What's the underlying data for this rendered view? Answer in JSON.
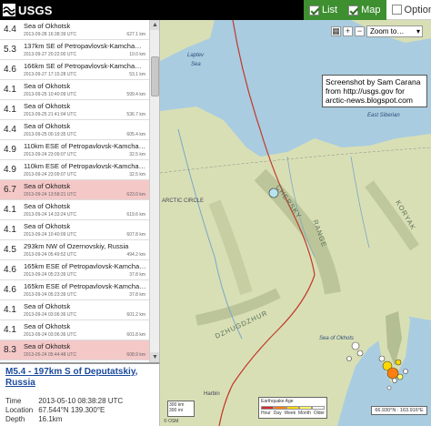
{
  "header": {
    "logo_text": "USGS",
    "view_toggle": [
      {
        "label": "List",
        "checked": true
      },
      {
        "label": "Map",
        "checked": true
      },
      {
        "label": "Options",
        "checked": false
      }
    ]
  },
  "earthquakes": [
    {
      "mag": "4.4",
      "place": "Sea of Okhotsk",
      "time": "2013-09-28 16:38:39 UTC",
      "depth": "627.1 km",
      "highlight": false
    },
    {
      "mag": "5.3",
      "place": "137km SE of Petropavlovsk-Kamcha…",
      "time": "2013-09-27 20:22:00 UTC",
      "depth": "10.0 km",
      "highlight": false
    },
    {
      "mag": "4.6",
      "place": "166km SE of Petropavlovsk-Kamcha…",
      "time": "2013-09-27 17:15:28 UTC",
      "depth": "53.1 km",
      "highlight": false
    },
    {
      "mag": "4.1",
      "place": "Sea of Okhotsk",
      "time": "2013-09-25 10:40:09 UTC",
      "depth": "599.4 km",
      "highlight": false
    },
    {
      "mag": "4.1",
      "place": "Sea of Okhotsk",
      "time": "2013-09-25 21:41:04 UTC",
      "depth": "536.7 km",
      "highlight": false
    },
    {
      "mag": "4.4",
      "place": "Sea of Okhotsk",
      "time": "2013-09-25 00:19:35 UTC",
      "depth": "605.4 km",
      "highlight": false
    },
    {
      "mag": "4.9",
      "place": "110km ESE of Petropavlovsk-Kamcha…",
      "time": "2013-09-24 23:09:07 UTC",
      "depth": "32.5 km",
      "highlight": false
    },
    {
      "mag": "4.9",
      "place": "110km ESE of Petropavlovsk-Kamcha…",
      "time": "2013-09-24 23:09:07 UTC",
      "depth": "32.5 km",
      "highlight": false
    },
    {
      "mag": "6.7",
      "place": "Sea of Okhotsk",
      "time": "2013-09-24 13:58:21 UTC",
      "depth": "623.0 km",
      "highlight": true
    },
    {
      "mag": "4.1",
      "place": "Sea of Okhotsk",
      "time": "2013-09-24 14:33:24 UTC",
      "depth": "619.6 km",
      "highlight": false
    },
    {
      "mag": "4.1",
      "place": "Sea of Okhotsk",
      "time": "2013-09-24 10:40:09 UTC",
      "depth": "607.8 km",
      "highlight": false
    },
    {
      "mag": "4.5",
      "place": "293km NW of Ozernovskiy, Russia",
      "time": "2013-09-24 05:49:52 UTC",
      "depth": "494.2 km",
      "highlight": false
    },
    {
      "mag": "4.6",
      "place": "165km ESE of Petropavlovsk-Kamcha…",
      "time": "2013-09-24 05:23:39 UTC",
      "depth": "37.8 km",
      "highlight": false
    },
    {
      "mag": "4.6",
      "place": "165km ESE of Petropavlovsk-Kamcha…",
      "time": "2013-09-24 05:23:39 UTC",
      "depth": "37.8 km",
      "highlight": false
    },
    {
      "mag": "4.1",
      "place": "Sea of Okhotsk",
      "time": "2013-09-24 03:06:36 UTC",
      "depth": "601.2 km",
      "highlight": false
    },
    {
      "mag": "4.1",
      "place": "Sea of Okhotsk",
      "time": "2013-09-24 03:06:36 UTC",
      "depth": "601.8 km",
      "highlight": false
    },
    {
      "mag": "8.3",
      "place": "Sea of Okhotsk",
      "time": "2013-05-24 05:44:48 UTC",
      "depth": "608.9 km",
      "highlight": true
    }
  ],
  "details": {
    "title": "M5.4 - 197km S of Deputatskiy, Russia",
    "time_label": "Time",
    "time_value": "2013-05-10 08:38:28 UTC",
    "location_label": "Location",
    "location_value": "67.544°N 139.300°E",
    "depth_label": "Depth",
    "depth_value": "16.1km"
  },
  "map": {
    "zoom_label": "Zoom to…",
    "control_plus": "+",
    "control_minus": "−",
    "control_grid": "▦",
    "note_lines": [
      "Screenshot by Sam Carana",
      "from http://usgs.gov for",
      "arctic-news.blogspot.com"
    ],
    "labels": {
      "laptev": "Laptev",
      "sea": "Sea",
      "east_siberian": "East Siberian",
      "arctic_circle": "ARCTIC CIRCLE",
      "chersky": "CHERSKY",
      "range": "RANGE",
      "dzhugdzhur": "DZHUGDZHUR",
      "koryak": "KORYAK",
      "sea_of_okhotsk": "Sea of Okhots",
      "harbin": "Harbin"
    },
    "scale_km": "300 km",
    "scale_mi": "300 mi",
    "legend_title": "Earthquake Age",
    "legend_items": [
      "Hour",
      "Day",
      "Week",
      "Month",
      "Older"
    ],
    "legend_colors": [
      "#d62728",
      "#ff7f0e",
      "#ffd700",
      "#ffff66",
      "#ffffff"
    ],
    "coords_text": "66.930°N : 163.916°E",
    "attr_text": "© OSM"
  },
  "colors": {
    "land": "#d9dfb5",
    "mountains": "#b9c49a",
    "ocean": "#a9cce0",
    "plate_boundary": "#c0392b",
    "highlight_row": "#f5c8c8",
    "header_active": "#3d8f2f"
  }
}
